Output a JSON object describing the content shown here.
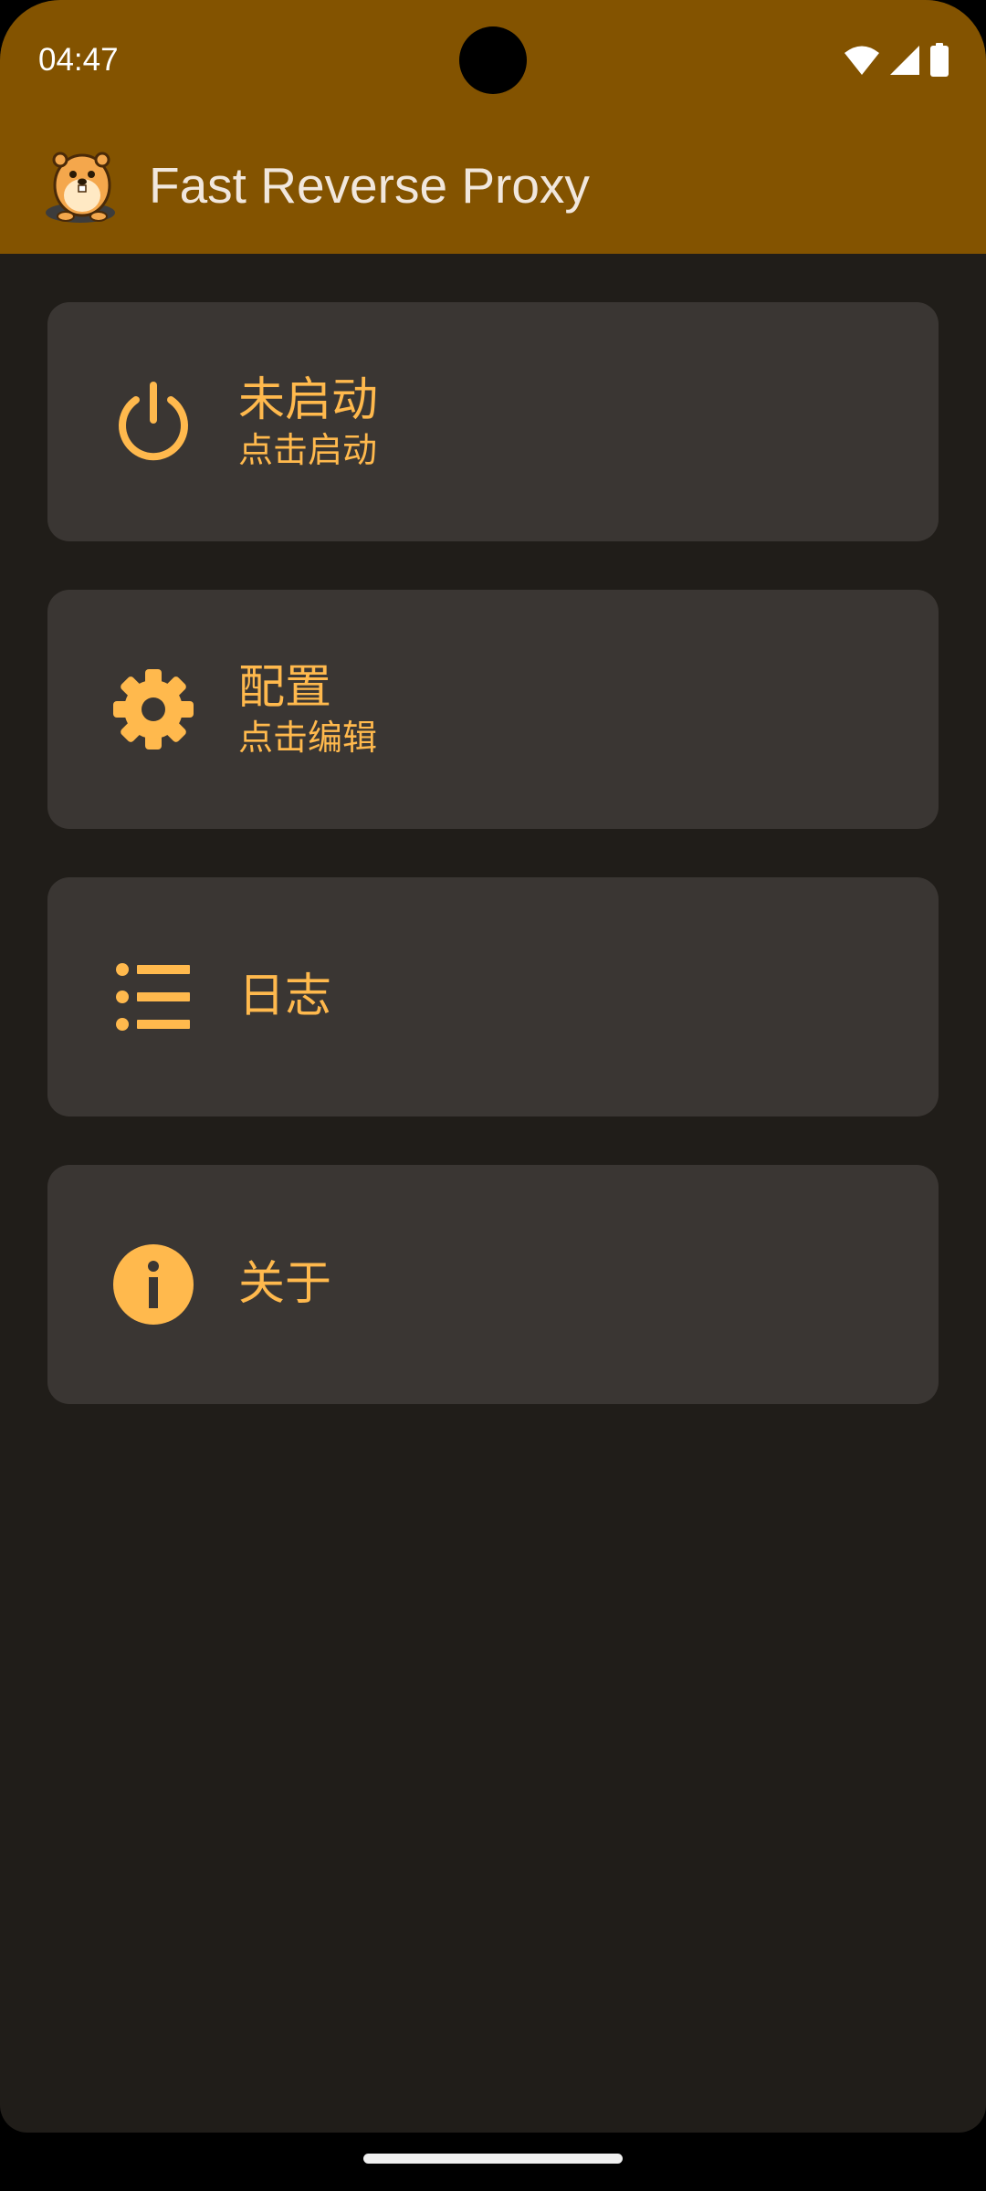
{
  "status_bar": {
    "time": "04:47",
    "icons": [
      "wifi-icon",
      "cellular-signal-icon",
      "battery-icon"
    ]
  },
  "app_bar": {
    "title": "Fast Reverse Proxy",
    "logo": "gopher-logo"
  },
  "cards": [
    {
      "id": "status",
      "icon": "power-icon",
      "title": "未启动",
      "subtitle": "点击启动"
    },
    {
      "id": "config",
      "icon": "gear-icon",
      "title": "配置",
      "subtitle": "点击编辑"
    },
    {
      "id": "log",
      "icon": "list-icon",
      "title": "日志"
    },
    {
      "id": "about",
      "icon": "info-icon",
      "title": "关于"
    }
  ],
  "colors": {
    "app_bar": "#835300",
    "background": "#201d19",
    "card": "#3a3633",
    "accent": "#ffb94d",
    "title_text": "#f1e7dd"
  }
}
